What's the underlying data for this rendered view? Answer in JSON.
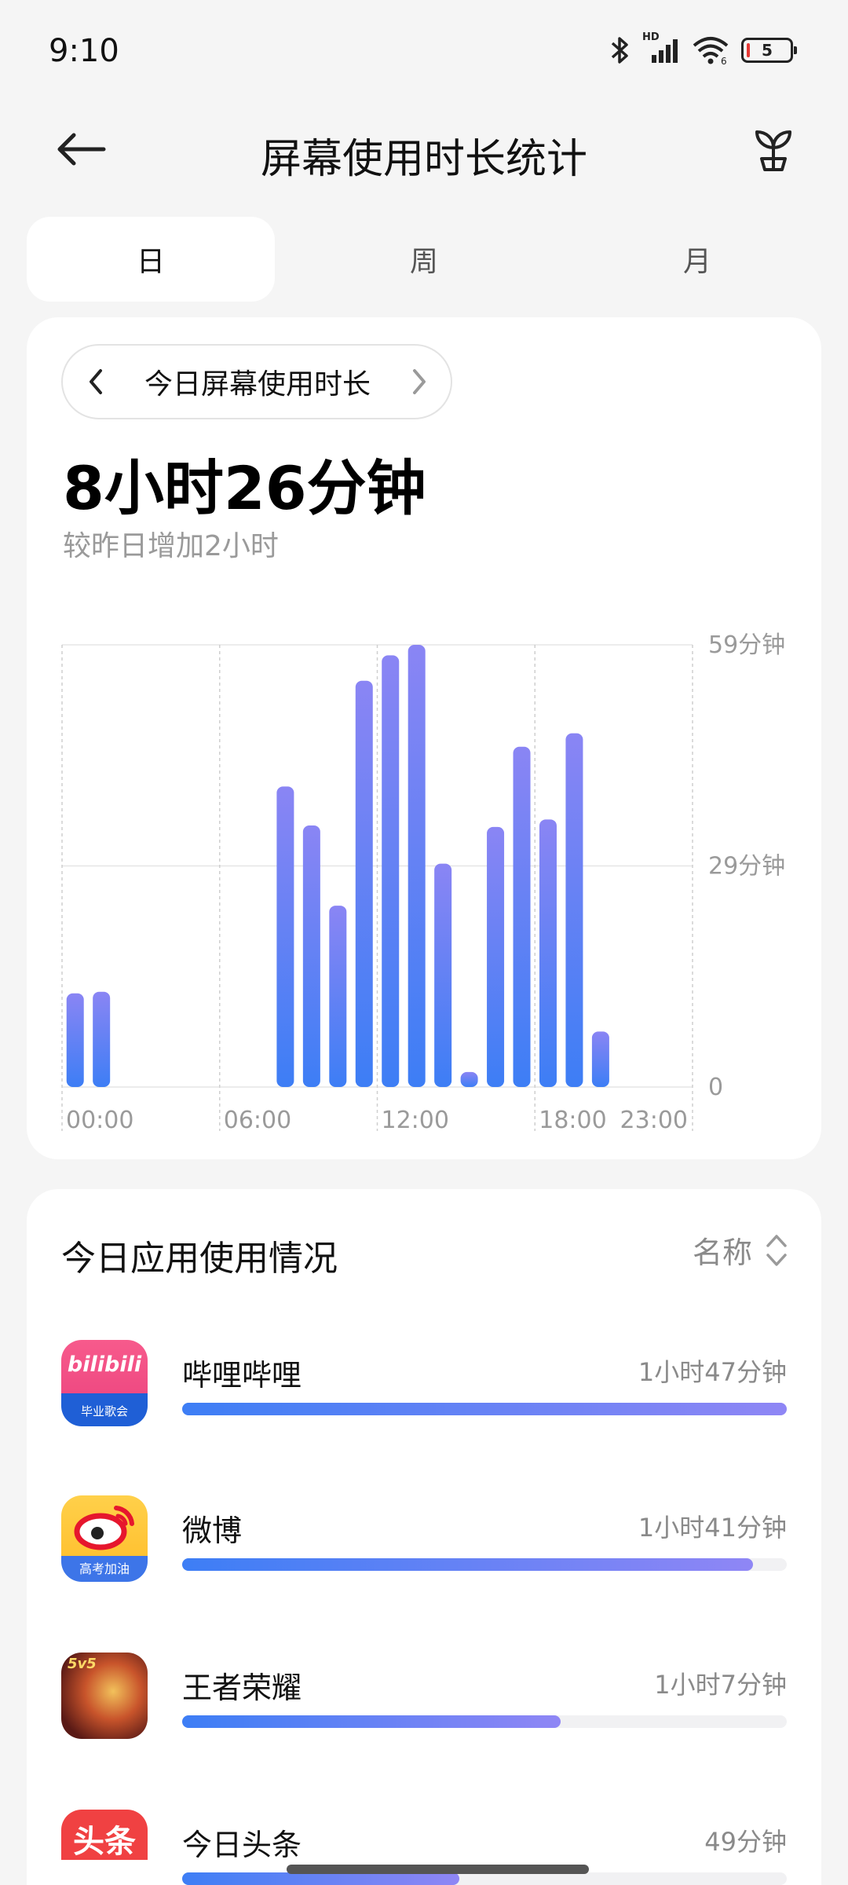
{
  "status_bar": {
    "time": "9:10",
    "network_label": "HD",
    "battery_level": "5"
  },
  "header": {
    "title": "屏幕使用时长统计",
    "back_icon": "back-arrow-icon",
    "right_icon": "sprout-icon"
  },
  "tabs": [
    {
      "label": "日",
      "active": true
    },
    {
      "label": "周",
      "active": false
    },
    {
      "label": "月",
      "active": false
    }
  ],
  "summary": {
    "period_label": "今日屏幕使用时长",
    "total_time": "8小时26分钟",
    "comparison": "较昨日增加2小时"
  },
  "chart_data": {
    "type": "bar",
    "x_tick_labels": [
      "00:00",
      "06:00",
      "12:00",
      "18:00",
      "23:00"
    ],
    "y_tick_labels": [
      "59分钟",
      "29分钟",
      "0"
    ],
    "ylim": [
      0,
      59
    ],
    "categories": [
      "00:00",
      "01:00",
      "02:00",
      "03:00",
      "04:00",
      "05:00",
      "06:00",
      "07:00",
      "08:00",
      "09:00",
      "10:00",
      "11:00",
      "12:00",
      "13:00",
      "14:00",
      "15:00",
      "16:00",
      "17:00",
      "18:00",
      "19:00",
      "20:00",
      "21:00",
      "22:00",
      "23:00"
    ],
    "values": [
      12.5,
      12.7,
      0,
      0,
      0,
      0,
      0,
      0,
      40.1,
      34.9,
      24.2,
      54.2,
      57.6,
      59.0,
      29.8,
      2.0,
      34.7,
      45.4,
      35.7,
      47.2,
      7.4,
      0,
      0,
      0
    ],
    "grid": true,
    "bar_gradient": [
      "#8a85f4",
      "#3d7ef5"
    ]
  },
  "apps_section": {
    "title": "今日应用使用情况",
    "sort_label": "名称",
    "sort_icon": "sort-updown-icon",
    "items": [
      {
        "name": "哔哩哔哩",
        "time": "1小时47分钟",
        "fraction": 1.0,
        "icon": "bilibili-icon",
        "icon_text": "bilibili",
        "icon_badge": "毕业歌会"
      },
      {
        "name": "微博",
        "time": "1小时41分钟",
        "fraction": 0.944,
        "icon": "weibo-icon",
        "icon_text": "",
        "icon_badge": "高考加油"
      },
      {
        "name": "王者荣耀",
        "time": "1小时7分钟",
        "fraction": 0.626,
        "icon": "honor-of-kings-icon",
        "icon_text": "5v5",
        "icon_badge": ""
      },
      {
        "name": "今日头条",
        "time": "49分钟",
        "fraction": 0.458,
        "icon": "toutiao-icon",
        "icon_text": "头条",
        "icon_badge": ""
      }
    ]
  },
  "colors": {
    "accent_start": "#3d7ef5",
    "accent_end": "#8f86f5",
    "background": "#f5f5f5",
    "card": "#ffffff"
  }
}
